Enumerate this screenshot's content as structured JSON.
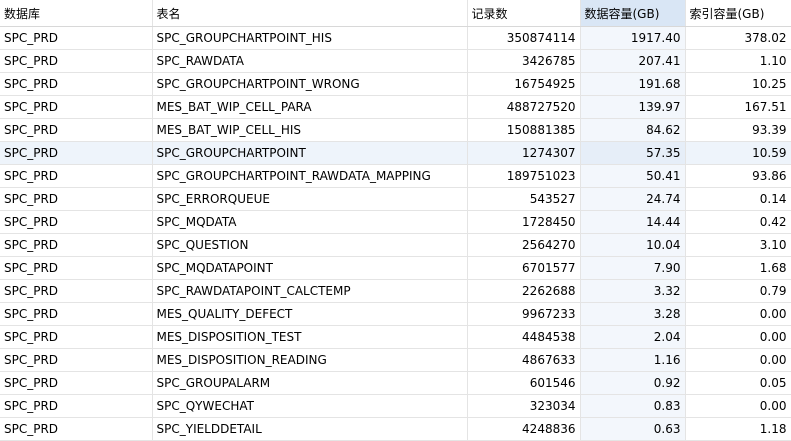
{
  "headers": {
    "db": "数据库",
    "table": "表名",
    "records": "记录数",
    "data_gb": "数据容量(GB)",
    "index_gb": "索引容量(GB)"
  },
  "rows": [
    {
      "db": "SPC_PRD",
      "table": "SPC_GROUPCHARTPOINT_HIS",
      "records": "350874114",
      "data_gb": "1917.40",
      "index_gb": "378.02"
    },
    {
      "db": "SPC_PRD",
      "table": "SPC_RAWDATA",
      "records": "3426785",
      "data_gb": "207.41",
      "index_gb": "1.10"
    },
    {
      "db": "SPC_PRD",
      "table": "SPC_GROUPCHARTPOINT_WRONG",
      "records": "16754925",
      "data_gb": "191.68",
      "index_gb": "10.25"
    },
    {
      "db": "SPC_PRD",
      "table": "MES_BAT_WIP_CELL_PARA",
      "records": "488727520",
      "data_gb": "139.97",
      "index_gb": "167.51"
    },
    {
      "db": "SPC_PRD",
      "table": "MES_BAT_WIP_CELL_HIS",
      "records": "150881385",
      "data_gb": "84.62",
      "index_gb": "93.39"
    },
    {
      "db": "SPC_PRD",
      "table": "SPC_GROUPCHARTPOINT",
      "records": "1274307",
      "data_gb": "57.35",
      "index_gb": "10.59"
    },
    {
      "db": "SPC_PRD",
      "table": "SPC_GROUPCHARTPOINT_RAWDATA_MAPPING",
      "records": "189751023",
      "data_gb": "50.41",
      "index_gb": "93.86"
    },
    {
      "db": "SPC_PRD",
      "table": "SPC_ERRORQUEUE",
      "records": "543527",
      "data_gb": "24.74",
      "index_gb": "0.14"
    },
    {
      "db": "SPC_PRD",
      "table": "SPC_MQDATA",
      "records": "1728450",
      "data_gb": "14.44",
      "index_gb": "0.42"
    },
    {
      "db": "SPC_PRD",
      "table": "SPC_QUESTION",
      "records": "2564270",
      "data_gb": "10.04",
      "index_gb": "3.10"
    },
    {
      "db": "SPC_PRD",
      "table": "SPC_MQDATAPOINT",
      "records": "6701577",
      "data_gb": "7.90",
      "index_gb": "1.68"
    },
    {
      "db": "SPC_PRD",
      "table": "SPC_RAWDATAPOINT_CALCTEMP",
      "records": "2262688",
      "data_gb": "3.32",
      "index_gb": "0.79"
    },
    {
      "db": "SPC_PRD",
      "table": "MES_QUALITY_DEFECT",
      "records": "9967233",
      "data_gb": "3.28",
      "index_gb": "0.00"
    },
    {
      "db": "SPC_PRD",
      "table": "MES_DISPOSITION_TEST",
      "records": "4484538",
      "data_gb": "2.04",
      "index_gb": "0.00"
    },
    {
      "db": "SPC_PRD",
      "table": "MES_DISPOSITION_READING",
      "records": "4867633",
      "data_gb": "1.16",
      "index_gb": "0.00"
    },
    {
      "db": "SPC_PRD",
      "table": "SPC_GROUPALARM",
      "records": "601546",
      "data_gb": "0.92",
      "index_gb": "0.05"
    },
    {
      "db": "SPC_PRD",
      "table": "SPC_QYWECHAT",
      "records": "323034",
      "data_gb": "0.83",
      "index_gb": "0.00"
    },
    {
      "db": "SPC_PRD",
      "table": "SPC_YIELDDETAIL",
      "records": "4248836",
      "data_gb": "0.63",
      "index_gb": "1.18"
    }
  ]
}
